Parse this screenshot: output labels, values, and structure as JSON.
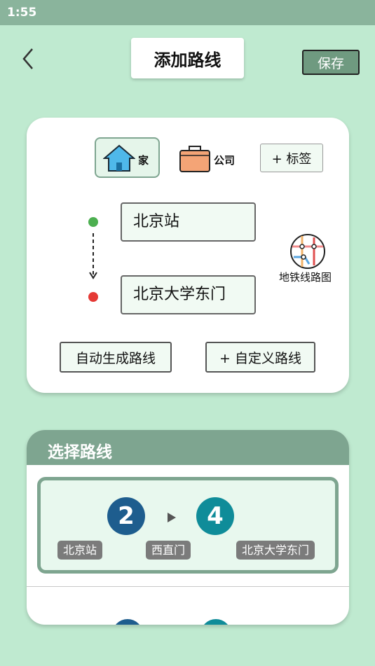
{
  "status_bar": {
    "time": "1:55"
  },
  "header": {
    "title": "添加路线",
    "save_label": "保存"
  },
  "tags": {
    "home": "家",
    "company": "公司",
    "add_tag": "+ 标签"
  },
  "stations": {
    "from": "北京站",
    "to": "北京大学东门"
  },
  "metro_map_label": "地铁线路图",
  "actions": {
    "auto_generate": "自动生成路线",
    "custom_route": "+ 自定义路线"
  },
  "route_section": {
    "title": "选择路线",
    "options": [
      {
        "lines": [
          "2",
          "4"
        ],
        "stations": [
          "北京站",
          "西直门",
          "北京大学东门"
        ]
      }
    ]
  },
  "colors": {
    "background": "#bfead0",
    "accent": "#7ea590",
    "line_2": "#1e5d8e",
    "line_4": "#0f8c99",
    "start_dot": "#4caf50",
    "end_dot": "#e53935"
  }
}
